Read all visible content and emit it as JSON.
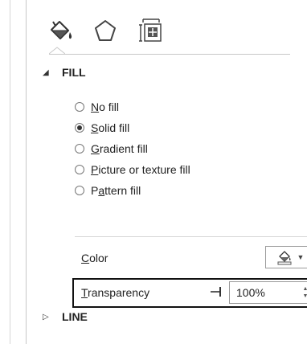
{
  "tabs": [
    {
      "icon": "fill-line-icon",
      "selected": true
    },
    {
      "icon": "effects-pentagon-icon",
      "selected": false
    },
    {
      "icon": "size-properties-icon",
      "selected": false
    }
  ],
  "fill_section": {
    "caret": "◢",
    "title": "FILL",
    "expanded": true,
    "options": [
      {
        "prefix": "",
        "accel": "N",
        "rest": "o fill",
        "checked": false
      },
      {
        "prefix": "",
        "accel": "S",
        "rest": "olid fill",
        "checked": true
      },
      {
        "prefix": "",
        "accel": "G",
        "rest": "radient fill",
        "checked": false
      },
      {
        "prefix": "",
        "accel": "P",
        "rest": "icture or texture fill",
        "checked": false
      },
      {
        "prefix": "P",
        "accel": "a",
        "rest": "ttern fill",
        "checked": false
      }
    ],
    "color": {
      "accel": "C",
      "rest": "olor",
      "dropdown_glyph": "▼"
    },
    "transparency": {
      "accel": "T",
      "rest": "ransparency",
      "value": "100%",
      "up": "▲",
      "down": "▼"
    }
  },
  "line_section": {
    "caret": "▷",
    "title": "LINE",
    "expanded": false
  }
}
